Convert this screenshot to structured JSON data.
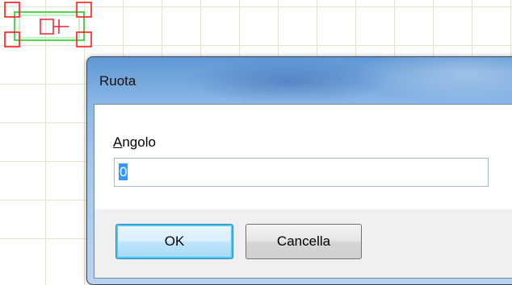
{
  "dialog": {
    "title": "Ruota",
    "angle_label_accesskey": "A",
    "angle_label_rest": "ngolo",
    "angle_value": "0",
    "ok_label": "OK",
    "cancel_label": "Cancella"
  },
  "colors": {
    "grid_line": "#e6e2d2",
    "component_outline": "#00cc00",
    "selection_handle": "#ff0000",
    "title_bar": "#8db8e6",
    "selection_highlight": "#3399ff"
  }
}
